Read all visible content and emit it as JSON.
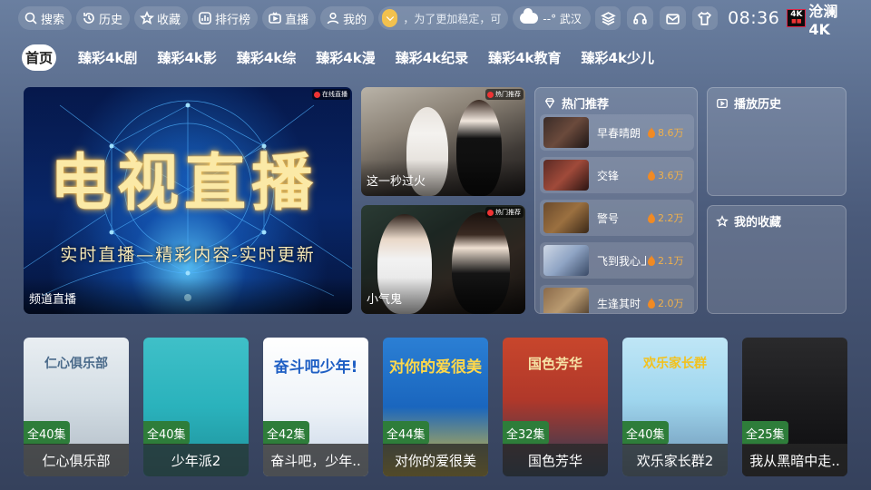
{
  "topbar": {
    "search": "搜索",
    "history": "历史",
    "favorites": "收藏",
    "ranking": "排行榜",
    "live": "直播",
    "mine": "我的",
    "notice": "，为了更加稳定，可",
    "weather": "--° 武汉",
    "time": "08:36",
    "brand": "沧澜4K",
    "brand_logo": "4K",
    "accent": "#f2c14e"
  },
  "tabs": [
    "首页",
    "臻彩4k剧",
    "臻彩4k影",
    "臻彩4k综",
    "臻彩4k漫",
    "臻彩4k纪录",
    "臻彩4k教育",
    "臻彩4k少儿"
  ],
  "hero": {
    "big_text": "电视直播",
    "sub_text": "实时直播—精彩内容-实时更新",
    "caption": "频道直播",
    "badge": "在线直播"
  },
  "mid": [
    {
      "caption": "这一秒过火",
      "badge": "热门推荐"
    },
    {
      "caption": "小气鬼",
      "badge": "热门推荐"
    }
  ],
  "hot": {
    "title": "热门推荐",
    "items": [
      {
        "name": "早春晴朗",
        "count": "8.6万"
      },
      {
        "name": "交锋",
        "count": "3.6万"
      },
      {
        "name": "警号",
        "count": "2.2万"
      },
      {
        "name": "飞到我心上",
        "count": "2.1万"
      },
      {
        "name": "生逢其时",
        "count": "2.0万"
      }
    ]
  },
  "history_panel": {
    "title": "播放历史"
  },
  "favorites_panel": {
    "title": "我的收藏"
  },
  "posters": [
    {
      "episodes": "全40集",
      "title": "仁心俱乐部",
      "heading": "仁心俱乐部"
    },
    {
      "episodes": "全40集",
      "title": "少年派2",
      "heading": ""
    },
    {
      "episodes": "全42集",
      "title": "奋斗吧，少年..",
      "heading": "奋斗吧少年!"
    },
    {
      "episodes": "全44集",
      "title": "对你的爱很美",
      "heading": "对你的爱很美"
    },
    {
      "episodes": "全32集",
      "title": "国色芳华",
      "heading": "国色芳华"
    },
    {
      "episodes": "全40集",
      "title": "欢乐家长群2",
      "heading": "欢乐家长群"
    },
    {
      "episodes": "全25集",
      "title": "我从黑暗中走..",
      "heading": ""
    }
  ]
}
